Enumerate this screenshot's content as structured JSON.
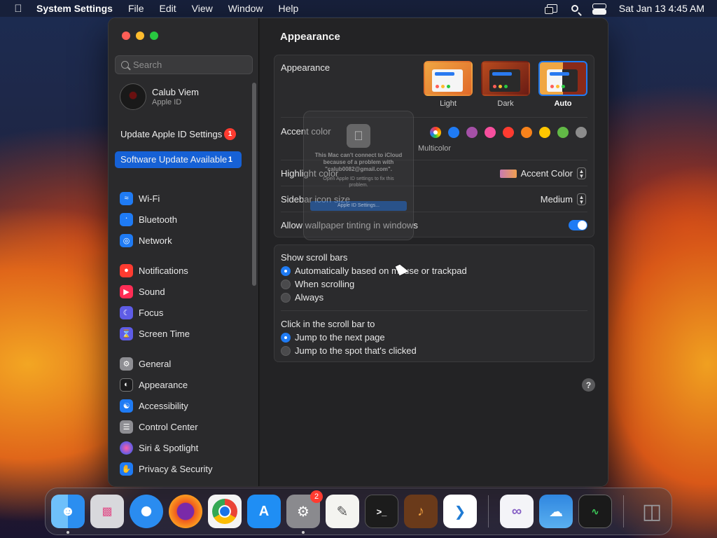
{
  "menubar": {
    "app_name": "System Settings",
    "menus": [
      "File",
      "Edit",
      "View",
      "Window",
      "Help"
    ],
    "clock": "Sat Jan 13  4:45 AM"
  },
  "sidebar": {
    "search_placeholder": "Search",
    "account": {
      "name": "Calub Viem",
      "subtitle": "Apple ID"
    },
    "notices": [
      {
        "label": "Update Apple ID Settings",
        "badge": "1"
      },
      {
        "label": "Software Update Available",
        "badge": "1"
      }
    ],
    "items": [
      {
        "label": "Wi-Fi",
        "icon": "wifi-icon",
        "color": "#1f7bf4"
      },
      {
        "label": "Bluetooth",
        "icon": "bluetooth-icon",
        "color": "#1f7bf4"
      },
      {
        "label": "Network",
        "icon": "globe-icon",
        "color": "#1f7bf4"
      },
      {
        "label": "Notifications",
        "icon": "bell-icon",
        "color": "#ff3b30"
      },
      {
        "label": "Sound",
        "icon": "speaker-icon",
        "color": "#ff2d55"
      },
      {
        "label": "Focus",
        "icon": "moon-icon",
        "color": "#5e5ce6"
      },
      {
        "label": "Screen Time",
        "icon": "hourglass-icon",
        "color": "#5e5ce6"
      },
      {
        "label": "General",
        "icon": "gear-icon",
        "color": "#8e8e93"
      },
      {
        "label": "Appearance",
        "icon": "appearance-icon",
        "color": "#1c1c1e"
      },
      {
        "label": "Accessibility",
        "icon": "accessibility-icon",
        "color": "#1f7bf4"
      },
      {
        "label": "Control Center",
        "icon": "control-center-icon",
        "color": "#8e8e93"
      },
      {
        "label": "Siri & Spotlight",
        "icon": "siri-icon",
        "color": "#a550a7"
      },
      {
        "label": "Privacy & Security",
        "icon": "hand-icon",
        "color": "#1f7bf4"
      }
    ]
  },
  "content": {
    "title": "Appearance",
    "appearance": {
      "label": "Appearance",
      "options": [
        {
          "label": "Light",
          "selected": false
        },
        {
          "label": "Dark",
          "selected": false
        },
        {
          "label": "Auto",
          "selected": true
        }
      ]
    },
    "accent": {
      "label": "Accent color",
      "multicolor_label": "Multicolor",
      "colors": [
        "#1f7bf4",
        "#a550a7",
        "#f74f9e",
        "#ff3b30",
        "#f7821b",
        "#ffc600",
        "#62ba46",
        "#8c8c8c"
      ]
    },
    "highlight": {
      "label": "Highlight color",
      "value": "Accent Color"
    },
    "sidebar_icon_size": {
      "label": "Sidebar icon size",
      "value": "Medium"
    },
    "wallpaper_tinting": {
      "label": "Allow wallpaper tinting in windows",
      "enabled": true
    },
    "scroll_bars": {
      "label": "Show scroll bars",
      "options": [
        {
          "label": "Automatically based on mouse or trackpad",
          "selected": true
        },
        {
          "label": "When scrolling",
          "selected": false
        },
        {
          "label": "Always",
          "selected": false
        }
      ]
    },
    "click_scroll": {
      "label": "Click in the scroll bar to",
      "options": [
        {
          "label": "Jump to the next page",
          "selected": true
        },
        {
          "label": "Jump to the spot that's clicked",
          "selected": false
        }
      ]
    },
    "help": "?"
  },
  "ghost_alert": {
    "title": "This Mac can't connect to iCloud because of a problem with \"calub0082@gmail.com\".",
    "message": "Open Apple ID settings to fix this problem.",
    "button": "Apple ID Settings..."
  },
  "dock": {
    "apps": [
      {
        "name": "Finder",
        "icon": "finder-icon",
        "color": "#2b8ef0",
        "running": true
      },
      {
        "name": "Launchpad",
        "icon": "launchpad-icon",
        "color": "#d8d8dc",
        "running": false
      },
      {
        "name": "Safari",
        "icon": "safari-icon",
        "color": "#2a8cf0",
        "running": false
      },
      {
        "name": "Firefox",
        "icon": "firefox-icon",
        "color": "#f05a1e",
        "running": false
      },
      {
        "name": "Chrome",
        "icon": "chrome-icon",
        "color": "#f4f4f4",
        "running": false
      },
      {
        "name": "App Store",
        "icon": "app-store-icon",
        "color": "#1f8ef4",
        "running": false
      },
      {
        "name": "System Settings",
        "icon": "system-settings-icon",
        "color": "#8a8a8e",
        "running": true,
        "badge": "2"
      },
      {
        "name": "TextEdit",
        "icon": "textedit-icon",
        "color": "#f4f4f0",
        "running": false
      },
      {
        "name": "Terminal",
        "icon": "terminal-icon",
        "color": "#1c1c1c",
        "running": false
      },
      {
        "name": "GarageBand",
        "icon": "garageband-icon",
        "color": "#6a3a1a",
        "running": false
      },
      {
        "name": "Visual Studio Code",
        "icon": "vscode-icon",
        "color": "#1f7bd4",
        "running": false
      }
    ],
    "apps_right": [
      {
        "name": "Visual Studio",
        "icon": "visual-studio-icon",
        "color": "#f4f4f8"
      },
      {
        "name": "Weather",
        "icon": "weather-icon",
        "color": "#2f86e0"
      },
      {
        "name": "Activity Monitor",
        "icon": "activity-monitor-icon",
        "color": "#1a1a1a"
      }
    ],
    "trash": {
      "name": "Trash",
      "icon": "trash-icon",
      "color": "#7a7a7e"
    }
  }
}
